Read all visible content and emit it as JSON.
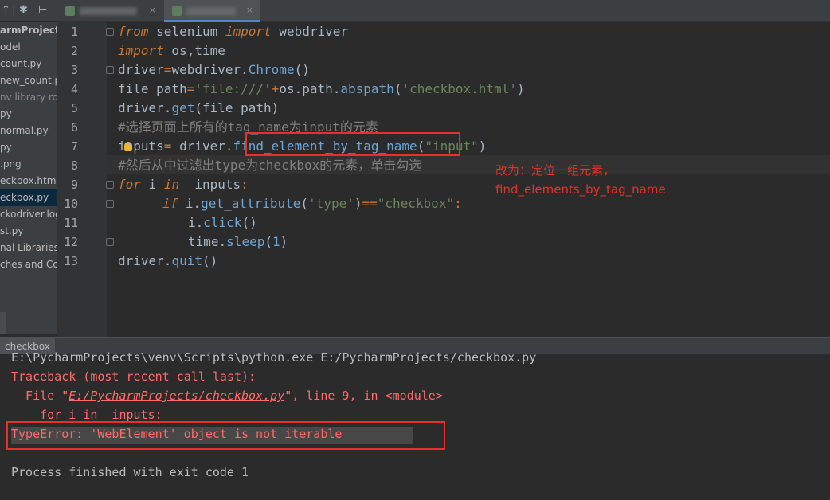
{
  "sidebar": {
    "toolbar": {
      "icon_a": "⇡",
      "sep": "|",
      "icon_b": "✱",
      "icon_c": "⊢"
    },
    "items": [
      {
        "label": "armProjects",
        "style": "bold"
      },
      {
        "label": "odel",
        "style": ""
      },
      {
        "label": "count.py",
        "style": ""
      },
      {
        "label": "new_count.p",
        "style": ""
      },
      {
        "label": "nv library ro",
        "style": "dim"
      },
      {
        "label": "py",
        "style": ""
      },
      {
        "label": "normal.py",
        "style": ""
      },
      {
        "label": "py",
        "style": ""
      },
      {
        "label": ".png",
        "style": ""
      },
      {
        "label": "eckbox.html",
        "style": ""
      },
      {
        "label": "eckbox.py",
        "style": "sel"
      },
      {
        "label": "ckodriver.log",
        "style": ""
      },
      {
        "label": "st.py",
        "style": ""
      },
      {
        "label": "nal Libraries",
        "style": ""
      },
      {
        "label": "ches and Cor",
        "style": ""
      }
    ]
  },
  "tabs": [
    {
      "icon": "python-file-icon",
      "close": "×"
    },
    {
      "icon": "python-file-icon",
      "close": "×"
    }
  ],
  "editor": {
    "line_numbers": [
      "1",
      "2",
      "3",
      "4",
      "5",
      "6",
      "7",
      "8",
      "9",
      "10",
      "11",
      "12",
      "13"
    ],
    "lines": {
      "l1": [
        "from",
        " selenium ",
        "import",
        " webdriver"
      ],
      "l2": [
        "import",
        " os,time"
      ],
      "l3": [
        "driver",
        "=",
        "webdriver.",
        "Chrome",
        "()"
      ],
      "l4": [
        "file_path",
        "=",
        "'file:///'",
        "+",
        "os.path.",
        "abspath",
        "(",
        "'checkbox.html'",
        ")"
      ],
      "l5": [
        "driver.",
        "get",
        "(file_path)"
      ],
      "l6": "#选择页面上所有的tag_name为input的元素",
      "l7": [
        "inputs",
        "=",
        " driver.",
        "find_element_by_tag_name",
        "(",
        "\"input\"",
        ")"
      ],
      "l8": "#然后从中过滤出type为checkbox的元素，单击勾选",
      "l9": [
        "for",
        " i ",
        "in",
        "  inputs",
        ":"
      ],
      "l10": [
        "if",
        " i.",
        "get_attribute",
        "(",
        "'type'",
        ")",
        "==",
        "\"checkbox\"",
        ":"
      ],
      "l11": [
        "i.",
        "click",
        "()"
      ],
      "l12": [
        "time.",
        "sleep",
        "(",
        "1",
        ")"
      ],
      "l13": [
        "driver.",
        "quit",
        "()"
      ]
    },
    "annotation": "改为：定位一组元素，\nfind_elements_by_tag_name"
  },
  "run": {
    "tab_label": "checkbox",
    "console": {
      "cmd": "E:\\PycharmProjects\\venv\\Scripts\\python.exe E:/PycharmProjects/checkbox.py",
      "traceback": "Traceback (most recent call last):",
      "file_pre": "  File \"",
      "file_link": "E:/PycharmProjects/checkbox.py",
      "file_post": "\", line 9, in <module>",
      "src": "    for i in  inputs:",
      "error": "TypeError: 'WebElement' object is not iterable",
      "exit": "Process finished with exit code 1"
    }
  },
  "colors": {
    "keyword": "#cc7832",
    "string": "#6a8759",
    "comment": "#808080",
    "method": "#6fa5d3",
    "error_text": "#ff6b68",
    "annotation": "#e5312d"
  }
}
